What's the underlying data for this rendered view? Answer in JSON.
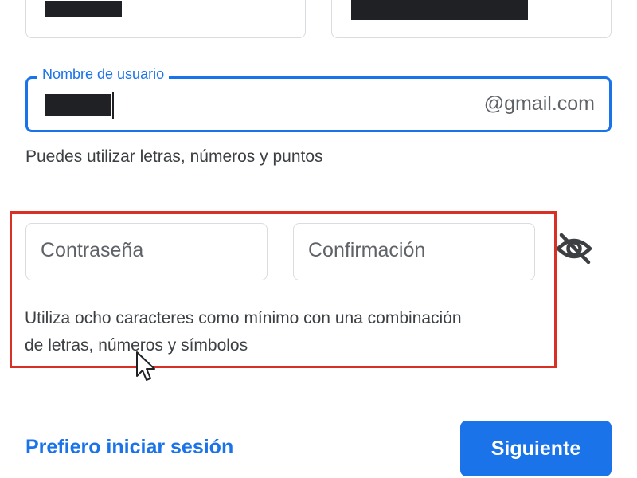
{
  "name_fields": {
    "first_name_value": "",
    "last_name_value": ""
  },
  "username": {
    "label": "Nombre de usuario",
    "value": "",
    "suffix": "@gmail.com",
    "helper": "Puedes utilizar letras, números y puntos"
  },
  "password": {
    "placeholder": "Contraseña",
    "confirm_placeholder": "Confirmación",
    "toggle_icon": "eye-off-icon",
    "helper_line1": "Utiliza ocho caracteres como mínimo con una combinación",
    "helper_line2": "de letras, números y símbolos"
  },
  "footer": {
    "signin_link": "Prefiero iniciar sesión",
    "next_button": "Siguiente"
  },
  "colors": {
    "accent": "#1a73e8",
    "border": "#dadce0",
    "highlight": "#d93025",
    "redaction": "#202124"
  }
}
